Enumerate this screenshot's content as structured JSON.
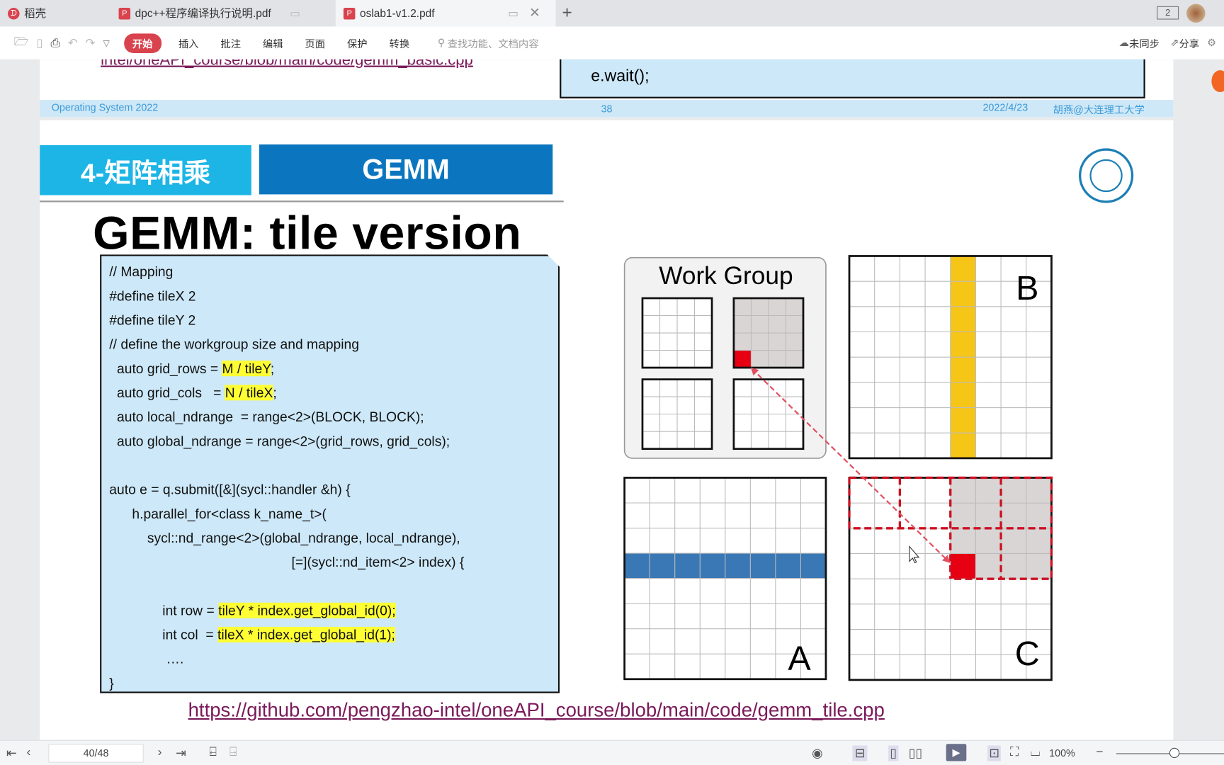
{
  "tabs": [
    {
      "label": "稻壳"
    },
    {
      "label": "dpc++程序编译执行说明.pdf"
    },
    {
      "label": "oslab1-v1.2.pdf",
      "active": true
    }
  ],
  "window": {
    "panel_count": "2"
  },
  "toolbar": {
    "menus": [
      "开始",
      "插入",
      "批注",
      "编辑",
      "页面",
      "保护",
      "转换"
    ],
    "search_placeholder": "查找功能、文档内容",
    "sync": "未同步",
    "share": "分享"
  },
  "prev_page": {
    "link": "intel/oneAPI_course/blob/main/code/gemm_basic.cpp",
    "code_tail": "e.wait();",
    "footer_left": "Operating System 2022",
    "footer_num": "38",
    "footer_date": "2022/4/23",
    "footer_author": "胡燕@大连理工大学"
  },
  "slide": {
    "section": "4-矩阵相乘",
    "section_en": "GEMM",
    "title": "GEMM: tile version",
    "code": [
      [
        {
          "t": "// Mapping"
        }
      ],
      [
        {
          "t": "#define tileX 2"
        }
      ],
      [
        {
          "t": "#define tileY 2"
        }
      ],
      [
        {
          "t": "// define the workgroup size and mapping"
        }
      ],
      [
        {
          "t": "  auto grid_rows = "
        },
        {
          "t": "M / tileY",
          "hl": true
        },
        {
          "t": ";"
        }
      ],
      [
        {
          "t": "  auto grid_cols   = "
        },
        {
          "t": "N / tileX",
          "hl": true
        },
        {
          "t": ";"
        }
      ],
      [
        {
          "t": "  auto local_ndrange  = range<2>(BLOCK, BLOCK);"
        }
      ],
      [
        {
          "t": "  auto global_ndrange = range<2>(grid_rows, grid_cols);"
        }
      ],
      [
        {
          "t": ""
        }
      ],
      [
        {
          "t": "auto e = q.submit([&](sycl::handler &h) {"
        }
      ],
      [
        {
          "t": "      h.parallel_for<class k_name_t>("
        }
      ],
      [
        {
          "t": "          sycl::nd_range<2>(global_ndrange, local_ndrange),"
        }
      ],
      [
        {
          "t": "                                                [=](sycl::nd_item<2> index) {"
        }
      ],
      [
        {
          "t": ""
        }
      ],
      [
        {
          "t": "              int row = "
        },
        {
          "t": "tileY * index.get_global_id(0);",
          "hl": true
        }
      ],
      [
        {
          "t": "              int col  = "
        },
        {
          "t": "tileX * index.get_global_id(1);",
          "hl": true
        }
      ],
      [
        {
          "t": "               …."
        }
      ],
      [
        {
          "t": "}"
        }
      ]
    ],
    "diagram": {
      "work_group_label": "Work Group",
      "matrix_a": "A",
      "matrix_b": "B",
      "matrix_c": "C",
      "colors": {
        "a_row": "#3a78b5",
        "b_col": "#f5c518",
        "tile": "#d9d5d5",
        "element": "#e60012",
        "dash": "#cc1122"
      }
    },
    "link": "https://github.com/pengzhao-intel/oneAPI_course/blob/main/code/gemm_tile.cpp"
  },
  "statusbar": {
    "page_input": "40/48",
    "zoom": "100%"
  }
}
